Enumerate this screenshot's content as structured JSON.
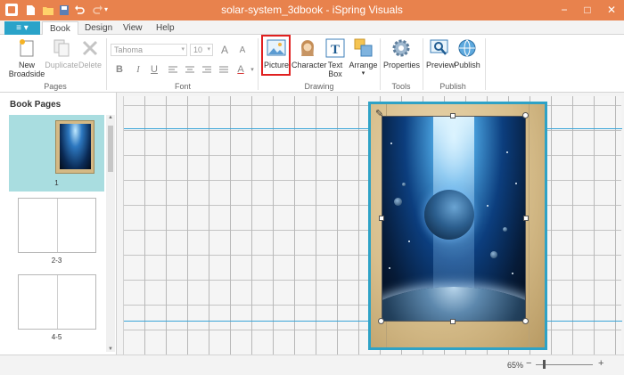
{
  "window": {
    "title": "solar-system_3dbook - iSpring Visuals",
    "minimize": "−",
    "maximize": "□",
    "close": "✕"
  },
  "quick_access": {
    "customize": "▾"
  },
  "ribbon_tabs": {
    "file_label": "≡ ▾",
    "tabs": [
      {
        "label": "Book",
        "active": true
      },
      {
        "label": "Design",
        "active": false
      },
      {
        "label": "View",
        "active": false
      },
      {
        "label": "Help",
        "active": false
      }
    ]
  },
  "ribbon": {
    "pages": {
      "group_label": "Pages",
      "new_broadside_line1": "New",
      "new_broadside_line2": "Broadside",
      "duplicate": "Duplicate",
      "delete": "Delete"
    },
    "font": {
      "group_label": "Font",
      "font_family": "Tahoma",
      "font_size": "10",
      "grow": "A",
      "shrink": "A",
      "bold": "B",
      "italic": "I",
      "underline": "U",
      "font_color": "A"
    },
    "drawing": {
      "group_label": "Drawing",
      "picture": "Picture",
      "character": "Character",
      "text_box_line1": "Text",
      "text_box_line2": "Box",
      "arrange": "Arrange"
    },
    "tools": {
      "group_label": "Tools",
      "properties": "Properties"
    },
    "publish": {
      "group_label": "Publish",
      "preview": "Preview",
      "publish": "Publish"
    }
  },
  "book_pages": {
    "title": "Book Pages",
    "pages": [
      {
        "label": "1",
        "selected": true
      },
      {
        "label": "2-3",
        "selected": false
      },
      {
        "label": "4-5",
        "selected": false
      }
    ]
  },
  "status": {
    "zoom": "65%",
    "zoom_out": "−",
    "zoom_in": "+"
  },
  "colors": {
    "title_bar": "#e8824d",
    "accent": "#2aa3c9",
    "selected_thumb": "#a9dde0",
    "picture_highlight": "#e02020"
  }
}
